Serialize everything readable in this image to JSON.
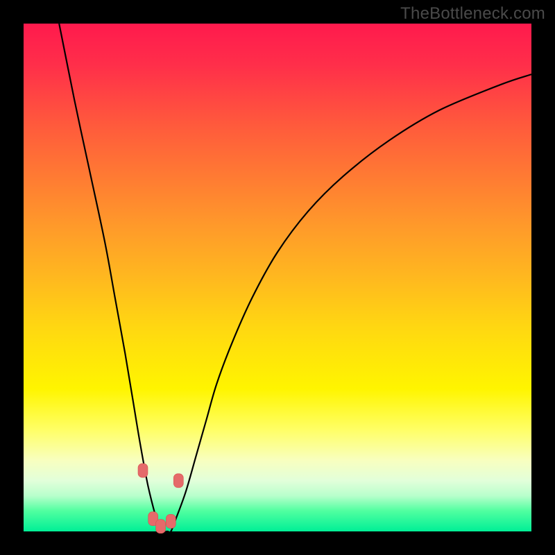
{
  "watermark": "TheBottleneck.com",
  "colors": {
    "background_black": "#000000",
    "gradient_top": "#ff1a4d",
    "gradient_bottom": "#00ef96",
    "marker_fill": "#e56a6a"
  },
  "chart_data": {
    "type": "line",
    "title": "",
    "xlabel": "",
    "ylabel": "",
    "xlim": [
      0,
      100
    ],
    "ylim": [
      0,
      100
    ],
    "grid": false,
    "series": [
      {
        "name": "bottleneck-curve",
        "x": [
          7,
          10,
          13,
          16,
          18,
          20,
          21.5,
          23,
          24.5,
          26,
          27,
          28.3,
          29,
          30,
          32,
          34,
          36,
          38,
          41,
          45,
          50,
          56,
          63,
          72,
          82,
          94,
          100
        ],
        "values": [
          100,
          85,
          71,
          57,
          46,
          35,
          26,
          17,
          9,
          3,
          0,
          0,
          0,
          2.5,
          8,
          15,
          22,
          29,
          37,
          46,
          55,
          63,
          70,
          77,
          83,
          88,
          90
        ]
      }
    ],
    "markers": [
      {
        "x": 23.5,
        "y": 12
      },
      {
        "x": 30.5,
        "y": 10
      },
      {
        "x": 25.5,
        "y": 2.5
      },
      {
        "x": 27.0,
        "y": 1.0
      },
      {
        "x": 29.0,
        "y": 2.0
      }
    ]
  }
}
